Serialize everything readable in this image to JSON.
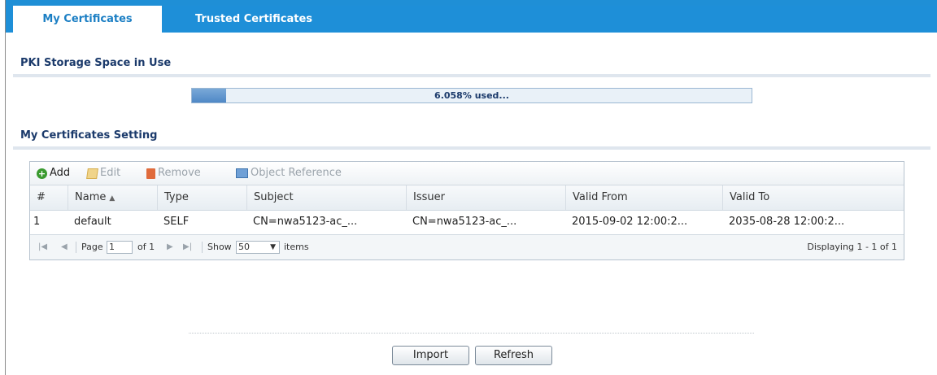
{
  "tabs": [
    {
      "label": "My Certificates",
      "active": true
    },
    {
      "label": "Trusted Certificates",
      "active": false
    }
  ],
  "storage": {
    "title": "PKI Storage Space in Use",
    "used_percent": 6.058,
    "used_label": "6.058% used..."
  },
  "settings": {
    "title": "My Certificates Setting",
    "toolbar": {
      "add": "Add",
      "edit": "Edit",
      "remove": "Remove",
      "object_reference": "Object Reference"
    },
    "columns": [
      "#",
      "Name",
      "Type",
      "Subject",
      "Issuer",
      "Valid From",
      "Valid To"
    ],
    "rows": [
      {
        "index": "1",
        "name": "default",
        "type": "SELF",
        "subject": "CN=nwa5123-ac_...",
        "issuer": "CN=nwa5123-ac_...",
        "valid_from": "2015-09-02 12:00:2...",
        "valid_to": "2035-08-28 12:00:2..."
      }
    ],
    "pager": {
      "page_label": "Page",
      "page_value": "1",
      "of_label": "of 1",
      "show_label": "Show",
      "show_value": "50",
      "items_label": "items",
      "display_text": "Displaying 1 - 1 of 1"
    }
  },
  "buttons": {
    "import": "Import",
    "refresh": "Refresh"
  },
  "colors": {
    "tab_bar": "#1e8fd8",
    "title": "#1b3a6b",
    "progress_fill": "#4f88c6"
  }
}
